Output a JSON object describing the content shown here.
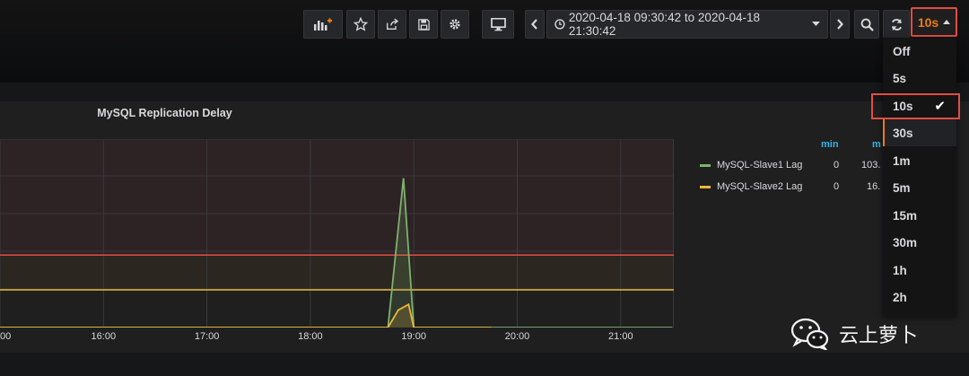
{
  "toolbar": {
    "add_panel_icon": "add-panel-icon",
    "star_icon": "star-icon",
    "share_icon": "share-icon",
    "save_icon": "save-icon",
    "settings_icon": "gear-icon",
    "tv_icon": "monitor-icon",
    "time_range": "2020-04-18 09:30:42 to 2020-04-18 21:30:42",
    "refresh_value": "10s"
  },
  "refresh_options": [
    "Off",
    "5s",
    "10s",
    "30s",
    "1m",
    "5m",
    "15m",
    "30m",
    "1h",
    "2h"
  ],
  "refresh_selected": "10s",
  "refresh_hover": "30s",
  "panel": {
    "title": "MySQL Replication Delay",
    "legend_headers": [
      "min",
      "m"
    ],
    "legend": [
      {
        "name": "MySQL-Slave1 Lag",
        "min": "0",
        "max": "103.",
        "color": "#7eb26d"
      },
      {
        "name": "MySQL-Slave2 Lag",
        "min": "0",
        "max": "16.",
        "color": "#eab839"
      }
    ]
  },
  "chart_data": {
    "type": "area",
    "x_ticks": [
      "00",
      "16:00",
      "17:00",
      "18:00",
      "19:00",
      "20:00",
      "21:00"
    ],
    "series": [
      {
        "name": "MySQL-Slave1 Lag",
        "x": [
          15.0,
          18.75,
          18.9,
          19.0,
          21.5
        ],
        "y": [
          0,
          0,
          103,
          0,
          0
        ]
      },
      {
        "name": "MySQL-Slave2 Lag",
        "x": [
          15.0,
          18.75,
          18.85,
          18.95,
          19.0,
          19.75
        ],
        "y": [
          0,
          0,
          12,
          16,
          0,
          0
        ]
      }
    ],
    "thresholds": [
      {
        "value": 50,
        "color": "#e24d42"
      },
      {
        "value": 26,
        "color": "#eab839"
      }
    ],
    "ylim": [
      0,
      130
    ]
  },
  "watermark": {
    "text": "云上萝卜",
    "icon": "wechat-icon"
  }
}
